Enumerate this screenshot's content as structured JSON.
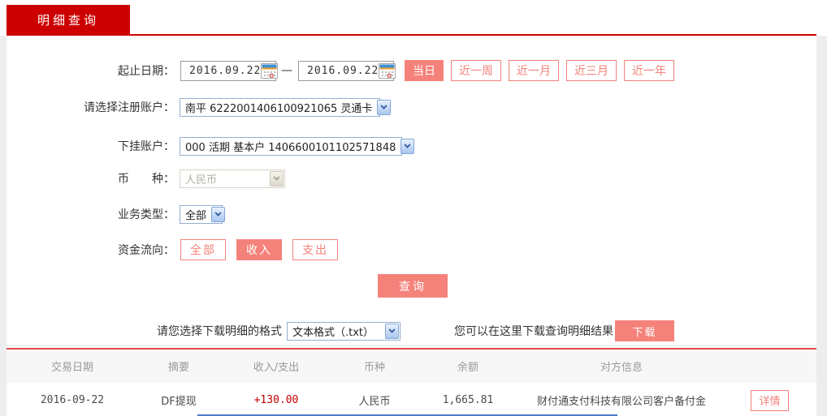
{
  "tab": {
    "label": "明细查询"
  },
  "form": {
    "date_row": {
      "label": "起止日期：",
      "start_date": "2016.09.22",
      "end_date": "2016.09.22",
      "separator": "—",
      "quick_buttons": [
        {
          "label": "当日",
          "active": true
        },
        {
          "label": "近一周",
          "active": false
        },
        {
          "label": "近一月",
          "active": false
        },
        {
          "label": "近三月",
          "active": false
        },
        {
          "label": "近一年",
          "active": false
        }
      ]
    },
    "register_account": {
      "label": "请选择注册账户：",
      "value": "南平 6222001406100921065 灵通卡"
    },
    "sub_account": {
      "label": "下挂账户：",
      "value": "000 活期 基本户 1406600101102571848"
    },
    "currency": {
      "label": "币　　种：",
      "value": "人民币",
      "disabled": true
    },
    "business_type": {
      "label": "业务类型：",
      "value": "全部"
    },
    "fund_flow": {
      "label": "资金流向：",
      "options": [
        {
          "label": "全部",
          "active": false
        },
        {
          "label": "收入",
          "active": true
        },
        {
          "label": "支出",
          "active": false
        }
      ]
    },
    "query_button": "查询"
  },
  "download": {
    "format_label": "请您选择下载明细的格式",
    "format_value": "文本格式（.txt）",
    "hint": "您可以在这里下载查询明细结果",
    "button": "下载"
  },
  "table": {
    "headers": [
      "交易日期",
      "摘要",
      "收入/支出",
      "币种",
      "余额",
      "对方信息"
    ],
    "rows": [
      {
        "date": "2016-09-22",
        "summary": "DF提现",
        "amount": "+130.00",
        "currency": "人民币",
        "balance": "1,665.81",
        "counterparty": "财付通支付科技有限公司客户备付金",
        "detail_button": "详情"
      }
    ]
  },
  "icons": {
    "calendar": "calendar-icon",
    "chevron": "chevron-down-icon"
  },
  "colors": {
    "tab_red": "#cc0000",
    "accent_salmon": "#f4827a",
    "divider_red": "#e14b4b",
    "amount_red": "#c30000"
  }
}
